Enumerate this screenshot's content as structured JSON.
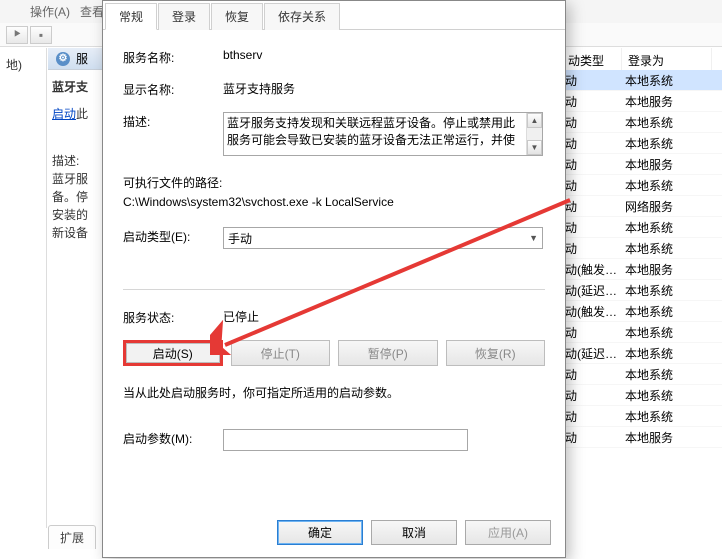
{
  "bg_menu": {
    "op": "操作(A)",
    "view": "查看("
  },
  "bg_left": {
    "item": "地)"
  },
  "service_panel_header_char": "服",
  "service_side": {
    "title": "蓝牙支",
    "start_link": "启动",
    "start_suffix": "此",
    "desc_label": "描述:",
    "desc_lines": [
      "蓝牙服",
      "备。停",
      "安装的",
      "新设备"
    ]
  },
  "bg_tab": {
    "ext": "扩展"
  },
  "right_table": {
    "headers": {
      "c1": "动类型",
      "c2": "登录为"
    },
    "rows": [
      {
        "c1": "动",
        "c2": "本地系统"
      },
      {
        "c1": "动",
        "c2": "本地服务"
      },
      {
        "c1": "动",
        "c2": "本地系统"
      },
      {
        "c1": "动",
        "c2": "本地系统"
      },
      {
        "c1": "动",
        "c2": "本地服务"
      },
      {
        "c1": "动",
        "c2": "本地系统"
      },
      {
        "c1": "动",
        "c2": "网络服务"
      },
      {
        "c1": "动",
        "c2": "本地系统"
      },
      {
        "c1": "动",
        "c2": "本地系统"
      },
      {
        "c1": "动(触发…",
        "c2": "本地服务"
      },
      {
        "c1": "动(延迟…",
        "c2": "本地系统"
      },
      {
        "c1": "动(触发…",
        "c2": "本地系统"
      },
      {
        "c1": "动",
        "c2": "本地系统"
      },
      {
        "c1": "动(延迟…",
        "c2": "本地系统"
      },
      {
        "c1": "动",
        "c2": "本地系统"
      },
      {
        "c1": "动",
        "c2": "本地系统"
      },
      {
        "c1": "动",
        "c2": "本地系统"
      },
      {
        "c1": "动",
        "c2": "本地服务"
      }
    ]
  },
  "dialog": {
    "tabs": {
      "general": "常规",
      "logon": "登录",
      "recovery": "恢复",
      "dependencies": "依存关系"
    },
    "labels": {
      "service_name": "服务名称:",
      "display_name": "显示名称:",
      "description": "描述:",
      "exe_path": "可执行文件的路径:",
      "startup_type": "启动类型(E):",
      "service_status": "服务状态:",
      "startup_param": "启动参数(M):"
    },
    "values": {
      "service_name": "bthserv",
      "display_name": "蓝牙支持服务",
      "description": "蓝牙服务支持发现和关联远程蓝牙设备。停止或禁用此服务可能会导致已安装的蓝牙设备无法正常运行，并使",
      "exe_path": "C:\\Windows\\system32\\svchost.exe -k LocalService",
      "startup_type": "手动",
      "service_status": "已停止"
    },
    "buttons": {
      "start": "启动(S)",
      "stop": "停止(T)",
      "pause": "暂停(P)",
      "resume": "恢复(R)"
    },
    "note": "当从此处启动服务时，你可指定所适用的启动参数。",
    "footer": {
      "ok": "确定",
      "cancel": "取消",
      "apply": "应用(A)"
    }
  }
}
